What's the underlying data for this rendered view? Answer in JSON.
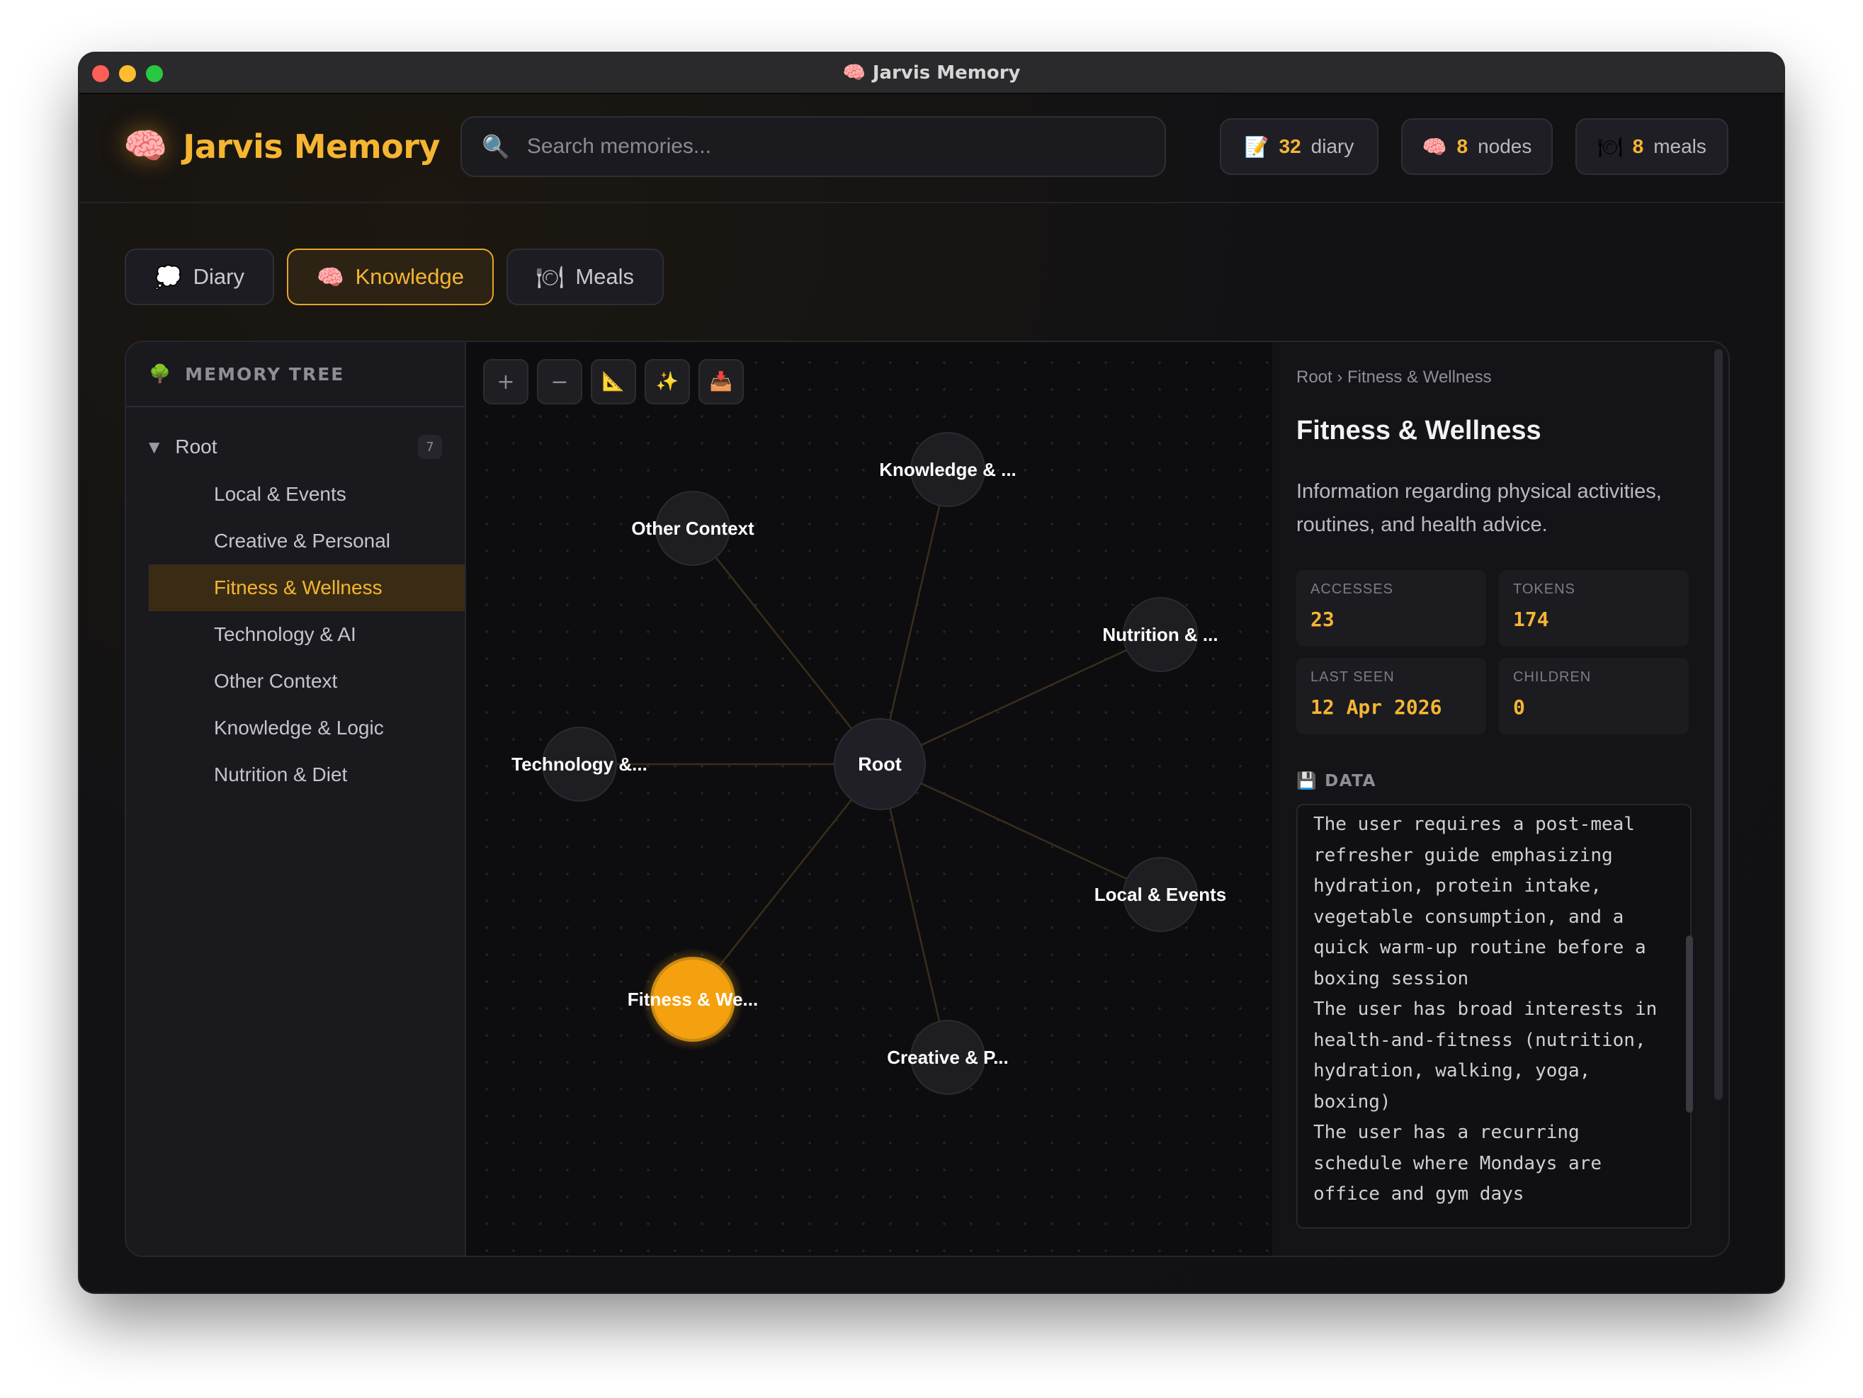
{
  "window": {
    "title": "Jarvis Memory",
    "title_icon": "🧠"
  },
  "header": {
    "logo_icon": "🧠",
    "logo_text": "Jarvis Memory",
    "search": {
      "placeholder": "Search memories...",
      "value": "",
      "icon": "🔍"
    },
    "stats": [
      {
        "icon": "📝",
        "value": "32",
        "label": "diary"
      },
      {
        "icon": "🧠",
        "value": "8",
        "label": "nodes"
      },
      {
        "icon": "🍽",
        "value": "8",
        "label": "meals"
      }
    ]
  },
  "tabs": [
    {
      "icon": "💭",
      "label": "Diary",
      "active": false
    },
    {
      "icon": "🧠",
      "label": "Knowledge",
      "active": true
    },
    {
      "icon": "🍽",
      "label": "Meals",
      "active": false
    }
  ],
  "sidebar": {
    "icon": "🌳",
    "title": "MEMORY TREE",
    "root": {
      "label": "Root",
      "count": "7",
      "caret": "▼"
    },
    "items": [
      {
        "label": "Local & Events",
        "active": false
      },
      {
        "label": "Creative & Personal",
        "active": false
      },
      {
        "label": "Fitness & Wellness",
        "active": true
      },
      {
        "label": "Technology & AI",
        "active": false
      },
      {
        "label": "Other Context",
        "active": false
      },
      {
        "label": "Knowledge & Logic",
        "active": false
      },
      {
        "label": "Nutrition & Diet",
        "active": false
      }
    ]
  },
  "graph": {
    "tools": [
      {
        "name": "zoom-in",
        "glyph": "+"
      },
      {
        "name": "zoom-out",
        "glyph": "−"
      },
      {
        "name": "fit",
        "glyph": "📐"
      },
      {
        "name": "sparkle",
        "glyph": "✨"
      },
      {
        "name": "export",
        "glyph": "📥"
      }
    ],
    "root_label": "Root",
    "nodes": [
      {
        "label": "Knowledge & ...",
        "selected": false
      },
      {
        "label": "Other Context",
        "selected": false
      },
      {
        "label": "Nutrition & ...",
        "selected": false
      },
      {
        "label": "Technology &...",
        "selected": false
      },
      {
        "label": "Local & Events",
        "selected": false
      },
      {
        "label": "Fitness & We...",
        "selected": true
      },
      {
        "label": "Creative & P...",
        "selected": false
      }
    ],
    "accent": "#f5a00f"
  },
  "detail": {
    "breadcrumb": "Root › Fitness & Wellness",
    "title": "Fitness & Wellness",
    "description": "Information regarding physical activities, routines, and health advice.",
    "stats": [
      {
        "label": "ACCESSES",
        "value": "23"
      },
      {
        "label": "TOKENS",
        "value": "174"
      },
      {
        "label": "LAST SEEN",
        "value": "12 Apr 2026"
      },
      {
        "label": "CHILDREN",
        "value": "0"
      }
    ],
    "data_icon": "💾",
    "data_label": "DATA",
    "data_lines": [
      "The user requires a post-meal",
      "refresher guide emphasizing",
      "hydration, protein intake,",
      "vegetable consumption, and a",
      "quick warm-up routine before a",
      "boxing session",
      "The user has broad interests in",
      "health-and-fitness (nutrition,",
      "hydration, walking, yoga,",
      "boxing)",
      "The user has a recurring",
      "schedule where Mondays are",
      "office and gym days"
    ]
  },
  "colors": {
    "accent": "#f5b532",
    "background": "#111114",
    "active_tab_bg": "#2c2315"
  }
}
